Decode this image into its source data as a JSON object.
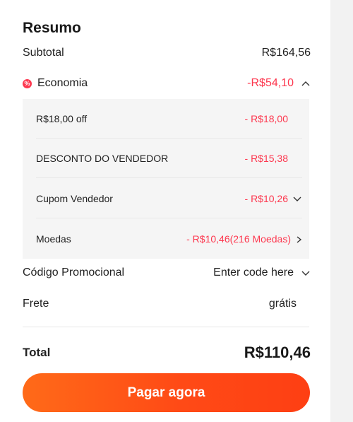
{
  "summary": {
    "title": "Resumo",
    "subtotal_label": "Subtotal",
    "subtotal_value": "R$164,56",
    "economy_label": "Economia",
    "economy_value": "-R$54,10",
    "economy_icon_glyph": "%",
    "details": [
      {
        "label": "R$18,00 off",
        "value": "- R$18,00",
        "icon": "none"
      },
      {
        "label": "DESCONTO DO VENDEDOR",
        "value": "- R$15,38",
        "icon": "none"
      },
      {
        "label": "Cupom Vendedor",
        "value": "- R$10,26",
        "icon": "chevron-down-icon"
      },
      {
        "label": "Moedas",
        "value": "- R$10,46(216 Moedas)",
        "icon": "chevron-right-icon"
      }
    ],
    "promo_label": "Código Promocional",
    "promo_value": "Enter code here",
    "shipping_label": "Frete",
    "shipping_value": "grátis",
    "total_label": "Total",
    "total_value": "R$110,46",
    "pay_button": "Pagar agora"
  },
  "colors": {
    "accent_red": "#fd384f",
    "button_orange": "#ff4a16"
  }
}
